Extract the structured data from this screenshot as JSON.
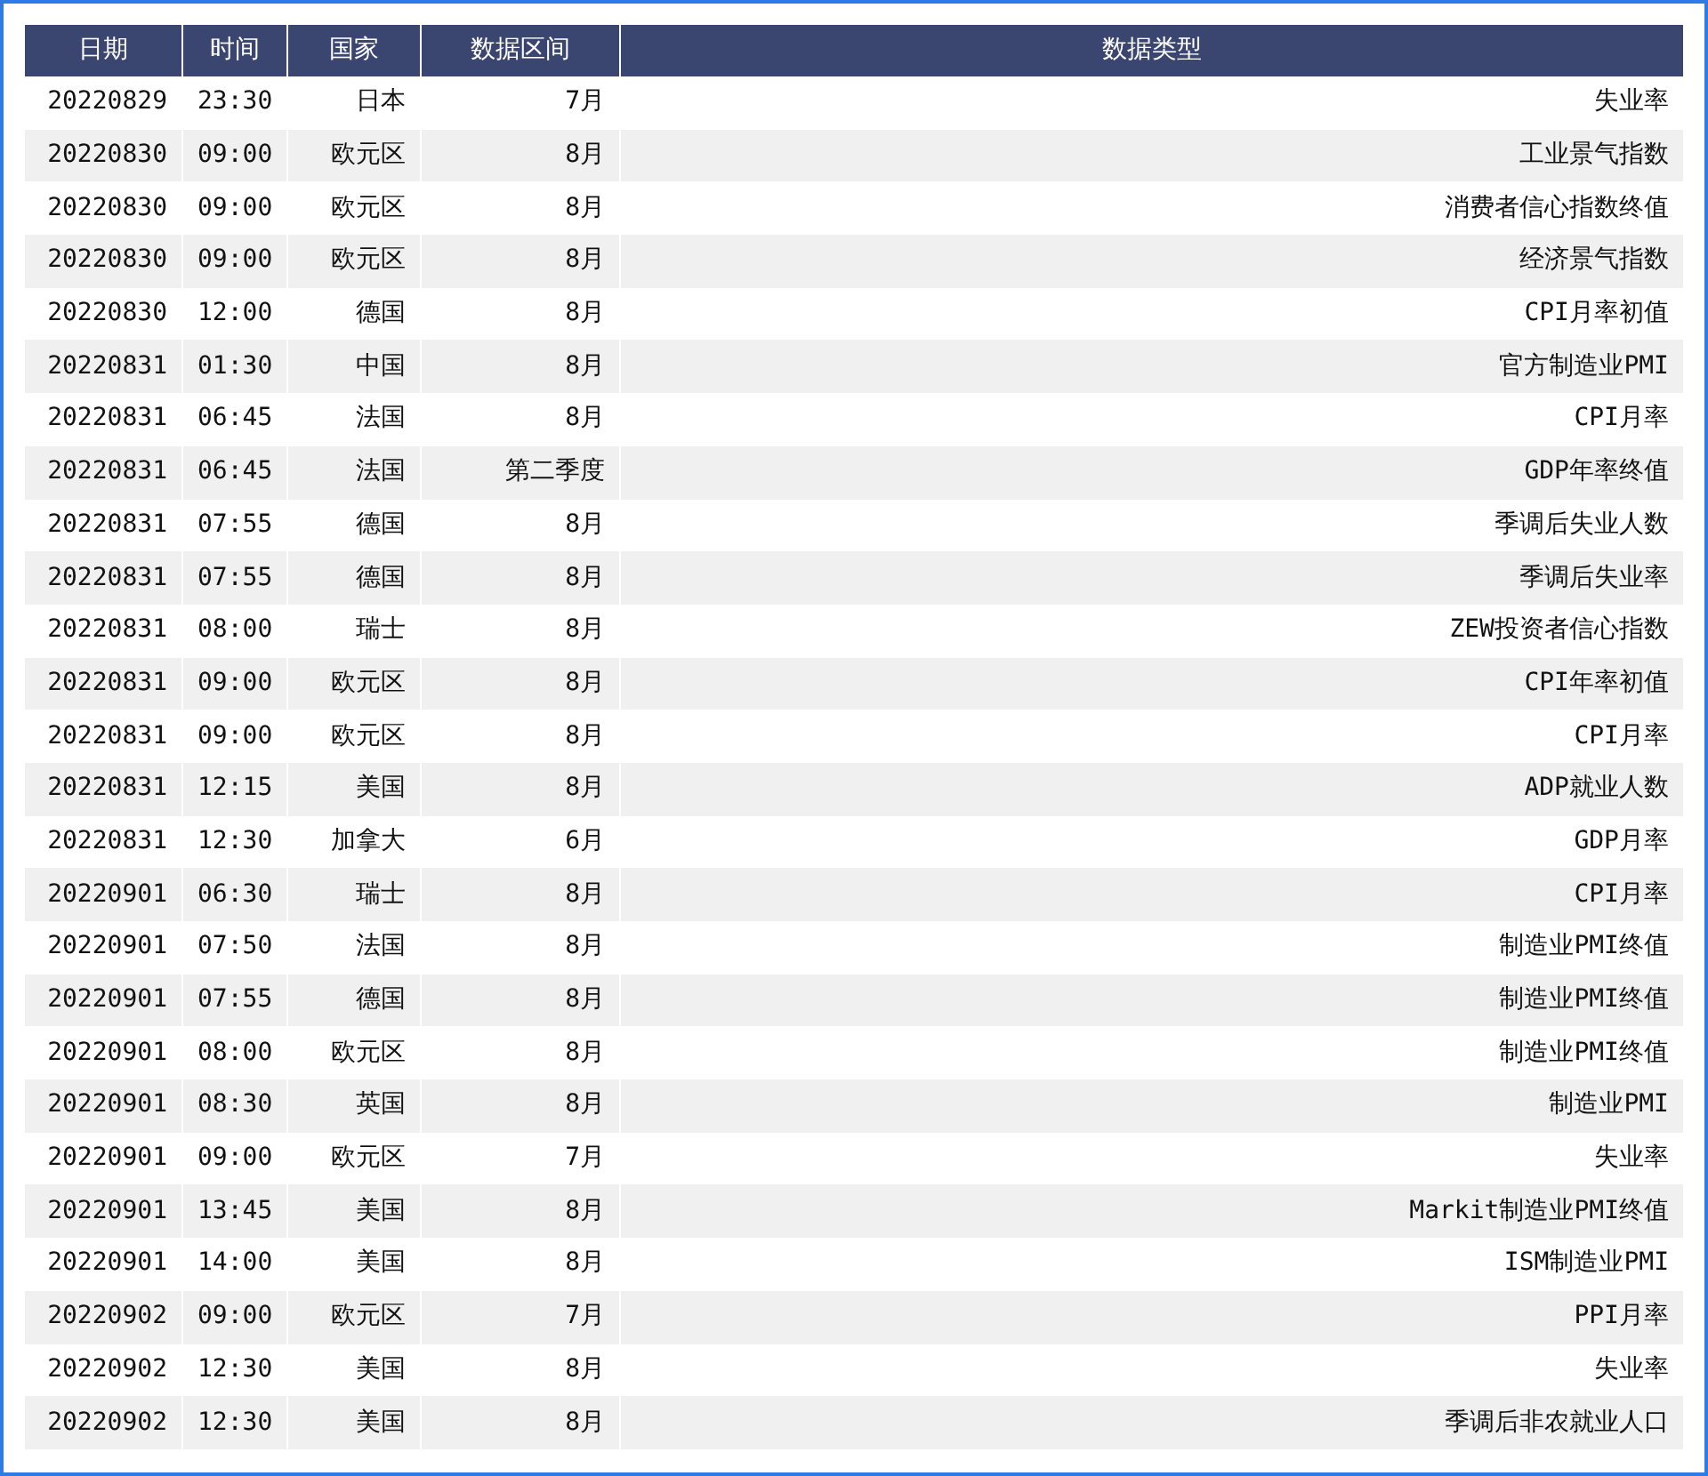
{
  "table": {
    "columns": [
      "日期",
      "时间",
      "国家",
      "数据区间",
      "数据类型"
    ],
    "rows": [
      [
        "20220829",
        "23:30",
        "日本",
        "7月",
        "失业率"
      ],
      [
        "20220830",
        "09:00",
        "欧元区",
        "8月",
        "工业景气指数"
      ],
      [
        "20220830",
        "09:00",
        "欧元区",
        "8月",
        "消费者信心指数终值"
      ],
      [
        "20220830",
        "09:00",
        "欧元区",
        "8月",
        "经济景气指数"
      ],
      [
        "20220830",
        "12:00",
        "德国",
        "8月",
        "CPI月率初值"
      ],
      [
        "20220831",
        "01:30",
        "中国",
        "8月",
        "官方制造业PMI"
      ],
      [
        "20220831",
        "06:45",
        "法国",
        "8月",
        "CPI月率"
      ],
      [
        "20220831",
        "06:45",
        "法国",
        "第二季度",
        "GDP年率终值"
      ],
      [
        "20220831",
        "07:55",
        "德国",
        "8月",
        "季调后失业人数"
      ],
      [
        "20220831",
        "07:55",
        "德国",
        "8月",
        "季调后失业率"
      ],
      [
        "20220831",
        "08:00",
        "瑞士",
        "8月",
        "ZEW投资者信心指数"
      ],
      [
        "20220831",
        "09:00",
        "欧元区",
        "8月",
        "CPI年率初值"
      ],
      [
        "20220831",
        "09:00",
        "欧元区",
        "8月",
        "CPI月率"
      ],
      [
        "20220831",
        "12:15",
        "美国",
        "8月",
        "ADP就业人数"
      ],
      [
        "20220831",
        "12:30",
        "加拿大",
        "6月",
        "GDP月率"
      ],
      [
        "20220901",
        "06:30",
        "瑞士",
        "8月",
        "CPI月率"
      ],
      [
        "20220901",
        "07:50",
        "法国",
        "8月",
        "制造业PMI终值"
      ],
      [
        "20220901",
        "07:55",
        "德国",
        "8月",
        "制造业PMI终值"
      ],
      [
        "20220901",
        "08:00",
        "欧元区",
        "8月",
        "制造业PMI终值"
      ],
      [
        "20220901",
        "08:30",
        "英国",
        "8月",
        "制造业PMI"
      ],
      [
        "20220901",
        "09:00",
        "欧元区",
        "7月",
        "失业率"
      ],
      [
        "20220901",
        "13:45",
        "美国",
        "8月",
        "Markit制造业PMI终值"
      ],
      [
        "20220901",
        "14:00",
        "美国",
        "8月",
        "ISM制造业PMI"
      ],
      [
        "20220902",
        "09:00",
        "欧元区",
        "7月",
        "PPI月率"
      ],
      [
        "20220902",
        "12:30",
        "美国",
        "8月",
        "失业率"
      ],
      [
        "20220902",
        "12:30",
        "美国",
        "8月",
        "季调后非农就业人口"
      ]
    ]
  }
}
